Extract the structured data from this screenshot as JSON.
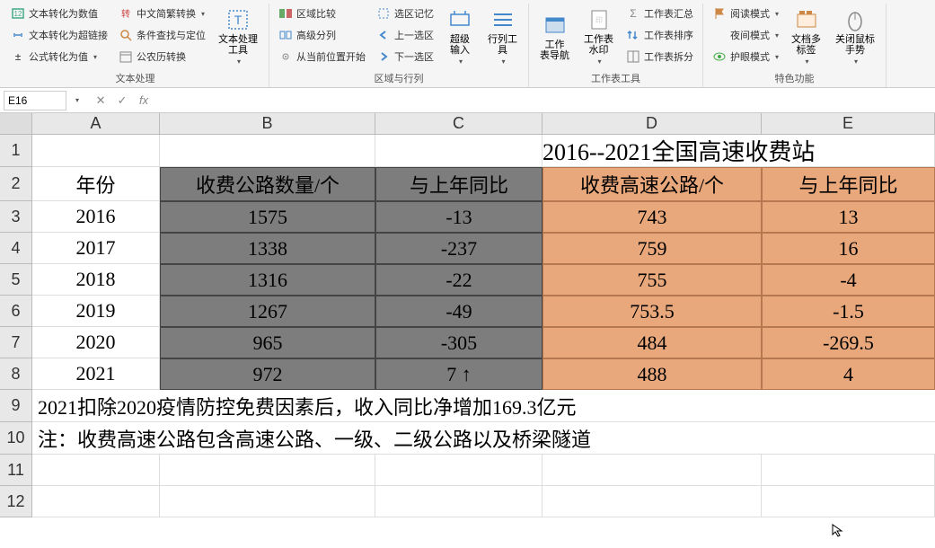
{
  "ribbon": {
    "text_processing": {
      "label": "文本处理",
      "text_to_value": "文本转化为数值",
      "text_to_link": "文本转化为超链接",
      "formula_to_value": "公式转化为值",
      "traditional_simplified": "中文简繁转换",
      "condition_find": "条件查找与定位",
      "calendar_convert": "公农历转换",
      "text_tools": "文本处理\n工具"
    },
    "region": {
      "label": "区域与行列",
      "region_compare": "区域比较",
      "advanced_split": "高级分列",
      "from_position": "从当前位置开始",
      "select_memory": "选区记忆",
      "prev_select": "上一选区",
      "next_select": "下一选区",
      "super_input": "超级\n输入",
      "row_tools": "行列工\n具"
    },
    "worksheet": {
      "label": "工作表工具",
      "sheet_nav": "工作\n表导航",
      "sheet_watermark": "工作表\n水印",
      "sheet_summary": "工作表汇总",
      "sheet_sort": "工作表排序",
      "sheet_split": "工作表拆分"
    },
    "features": {
      "label": "特色功能",
      "read_mode": "阅读模式",
      "night_mode": "夜间模式",
      "eye_protect": "护眼模式",
      "doc_tabs": "文档多\n标签",
      "close_mouse": "关闭鼠标\n手势"
    }
  },
  "cell_ref": "E16",
  "cols": [
    "A",
    "B",
    "C",
    "D",
    "E"
  ],
  "rows": [
    "1",
    "2",
    "3",
    "4",
    "5",
    "6",
    "7",
    "8",
    "9",
    "10",
    "11",
    "12"
  ],
  "title": "2016--2021全国高速收费站",
  "headers": {
    "year": "年份",
    "toll_road_count": "收费公路数量/个",
    "yoy1": "与上年同比",
    "toll_highway_count": "收费高速公路/个",
    "yoy2": "与上年同比"
  },
  "data": [
    {
      "year": "2016",
      "c1": "1575",
      "c2": "-13",
      "c3": "743",
      "c4": "13"
    },
    {
      "year": "2017",
      "c1": "1338",
      "c2": "-237",
      "c3": "759",
      "c4": "16"
    },
    {
      "year": "2018",
      "c1": "1316",
      "c2": "-22",
      "c3": "755",
      "c4": "-4"
    },
    {
      "year": "2019",
      "c1": "1267",
      "c2": "-49",
      "c3": "753.5",
      "c4": "-1.5"
    },
    {
      "year": "2020",
      "c1": "965",
      "c2": "-305",
      "c3": "484",
      "c4": "-269.5"
    },
    {
      "year": "2021",
      "c1": "972",
      "c2": "7 ↑",
      "c3": "488",
      "c4": "4"
    }
  ],
  "note1": "2021扣除2020疫情防控免费因素后，收入同比净增加169.3亿元",
  "note2": "注：收费高速公路包含高速公路、一级、二级公路以及桥梁隧道"
}
